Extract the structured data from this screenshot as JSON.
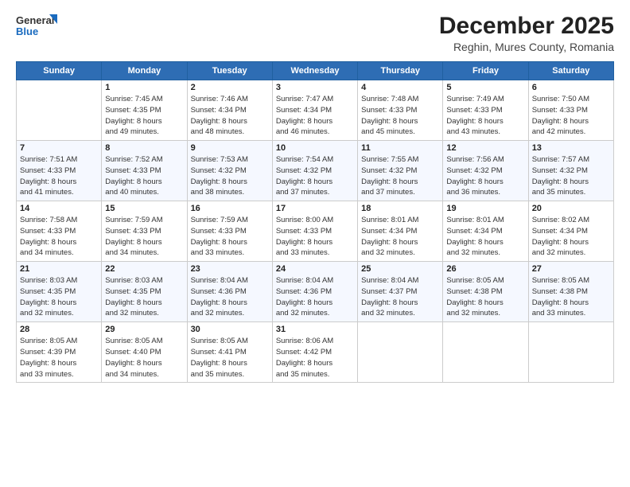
{
  "header": {
    "logo_line1": "General",
    "logo_line2": "Blue",
    "title": "December 2025",
    "subtitle": "Reghin, Mures County, Romania"
  },
  "calendar": {
    "days_of_week": [
      "Sunday",
      "Monday",
      "Tuesday",
      "Wednesday",
      "Thursday",
      "Friday",
      "Saturday"
    ],
    "weeks": [
      [
        {
          "day": "",
          "info": ""
        },
        {
          "day": "1",
          "info": "Sunrise: 7:45 AM\nSunset: 4:35 PM\nDaylight: 8 hours\nand 49 minutes."
        },
        {
          "day": "2",
          "info": "Sunrise: 7:46 AM\nSunset: 4:34 PM\nDaylight: 8 hours\nand 48 minutes."
        },
        {
          "day": "3",
          "info": "Sunrise: 7:47 AM\nSunset: 4:34 PM\nDaylight: 8 hours\nand 46 minutes."
        },
        {
          "day": "4",
          "info": "Sunrise: 7:48 AM\nSunset: 4:33 PM\nDaylight: 8 hours\nand 45 minutes."
        },
        {
          "day": "5",
          "info": "Sunrise: 7:49 AM\nSunset: 4:33 PM\nDaylight: 8 hours\nand 43 minutes."
        },
        {
          "day": "6",
          "info": "Sunrise: 7:50 AM\nSunset: 4:33 PM\nDaylight: 8 hours\nand 42 minutes."
        }
      ],
      [
        {
          "day": "7",
          "info": "Sunrise: 7:51 AM\nSunset: 4:33 PM\nDaylight: 8 hours\nand 41 minutes."
        },
        {
          "day": "8",
          "info": "Sunrise: 7:52 AM\nSunset: 4:33 PM\nDaylight: 8 hours\nand 40 minutes."
        },
        {
          "day": "9",
          "info": "Sunrise: 7:53 AM\nSunset: 4:32 PM\nDaylight: 8 hours\nand 38 minutes."
        },
        {
          "day": "10",
          "info": "Sunrise: 7:54 AM\nSunset: 4:32 PM\nDaylight: 8 hours\nand 37 minutes."
        },
        {
          "day": "11",
          "info": "Sunrise: 7:55 AM\nSunset: 4:32 PM\nDaylight: 8 hours\nand 37 minutes."
        },
        {
          "day": "12",
          "info": "Sunrise: 7:56 AM\nSunset: 4:32 PM\nDaylight: 8 hours\nand 36 minutes."
        },
        {
          "day": "13",
          "info": "Sunrise: 7:57 AM\nSunset: 4:32 PM\nDaylight: 8 hours\nand 35 minutes."
        }
      ],
      [
        {
          "day": "14",
          "info": "Sunrise: 7:58 AM\nSunset: 4:33 PM\nDaylight: 8 hours\nand 34 minutes."
        },
        {
          "day": "15",
          "info": "Sunrise: 7:59 AM\nSunset: 4:33 PM\nDaylight: 8 hours\nand 34 minutes."
        },
        {
          "day": "16",
          "info": "Sunrise: 7:59 AM\nSunset: 4:33 PM\nDaylight: 8 hours\nand 33 minutes."
        },
        {
          "day": "17",
          "info": "Sunrise: 8:00 AM\nSunset: 4:33 PM\nDaylight: 8 hours\nand 33 minutes."
        },
        {
          "day": "18",
          "info": "Sunrise: 8:01 AM\nSunset: 4:34 PM\nDaylight: 8 hours\nand 32 minutes."
        },
        {
          "day": "19",
          "info": "Sunrise: 8:01 AM\nSunset: 4:34 PM\nDaylight: 8 hours\nand 32 minutes."
        },
        {
          "day": "20",
          "info": "Sunrise: 8:02 AM\nSunset: 4:34 PM\nDaylight: 8 hours\nand 32 minutes."
        }
      ],
      [
        {
          "day": "21",
          "info": "Sunrise: 8:03 AM\nSunset: 4:35 PM\nDaylight: 8 hours\nand 32 minutes."
        },
        {
          "day": "22",
          "info": "Sunrise: 8:03 AM\nSunset: 4:35 PM\nDaylight: 8 hours\nand 32 minutes."
        },
        {
          "day": "23",
          "info": "Sunrise: 8:04 AM\nSunset: 4:36 PM\nDaylight: 8 hours\nand 32 minutes."
        },
        {
          "day": "24",
          "info": "Sunrise: 8:04 AM\nSunset: 4:36 PM\nDaylight: 8 hours\nand 32 minutes."
        },
        {
          "day": "25",
          "info": "Sunrise: 8:04 AM\nSunset: 4:37 PM\nDaylight: 8 hours\nand 32 minutes."
        },
        {
          "day": "26",
          "info": "Sunrise: 8:05 AM\nSunset: 4:38 PM\nDaylight: 8 hours\nand 32 minutes."
        },
        {
          "day": "27",
          "info": "Sunrise: 8:05 AM\nSunset: 4:38 PM\nDaylight: 8 hours\nand 33 minutes."
        }
      ],
      [
        {
          "day": "28",
          "info": "Sunrise: 8:05 AM\nSunset: 4:39 PM\nDaylight: 8 hours\nand 33 minutes."
        },
        {
          "day": "29",
          "info": "Sunrise: 8:05 AM\nSunset: 4:40 PM\nDaylight: 8 hours\nand 34 minutes."
        },
        {
          "day": "30",
          "info": "Sunrise: 8:05 AM\nSunset: 4:41 PM\nDaylight: 8 hours\nand 35 minutes."
        },
        {
          "day": "31",
          "info": "Sunrise: 8:06 AM\nSunset: 4:42 PM\nDaylight: 8 hours\nand 35 minutes."
        },
        {
          "day": "",
          "info": ""
        },
        {
          "day": "",
          "info": ""
        },
        {
          "day": "",
          "info": ""
        }
      ]
    ]
  }
}
